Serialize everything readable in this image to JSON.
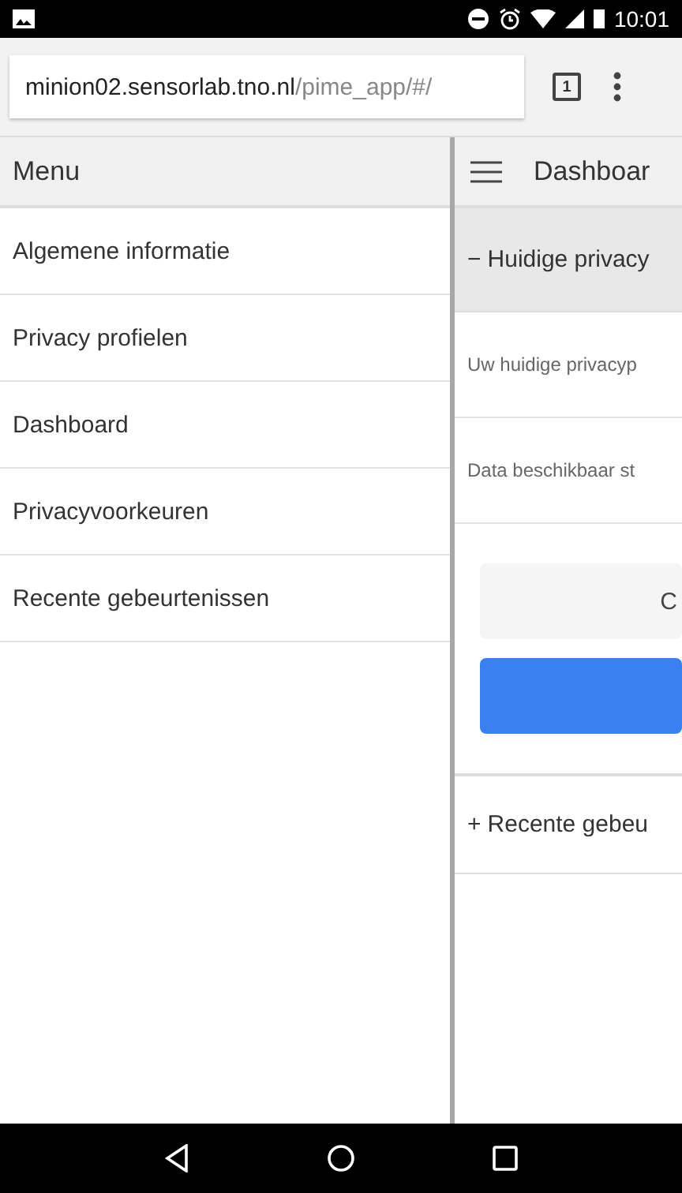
{
  "status_bar": {
    "time": "10:01"
  },
  "browser": {
    "url_host": "minion02.sensorlab.tno.nl",
    "url_path": "/pime_app/#/",
    "tab_count": "1"
  },
  "menu": {
    "title": "Menu",
    "items": [
      {
        "label": "Algemene informatie"
      },
      {
        "label": "Privacy profielen"
      },
      {
        "label": "Dashboard"
      },
      {
        "label": "Privacyvoorkeuren"
      },
      {
        "label": "Recente gebeurtenissen"
      }
    ]
  },
  "content": {
    "title": "Dashboar",
    "sections": [
      {
        "toggle": "−",
        "title": "Huidige privacy",
        "expanded": true,
        "rows": [
          "Uw huidige privacyp",
          "Data beschikbaar st"
        ],
        "buttons": [
          {
            "label": "C",
            "kind": "secondary"
          },
          {
            "kind": "primary"
          }
        ]
      },
      {
        "toggle": "+",
        "title": "Recente gebeu",
        "expanded": false
      }
    ]
  }
}
